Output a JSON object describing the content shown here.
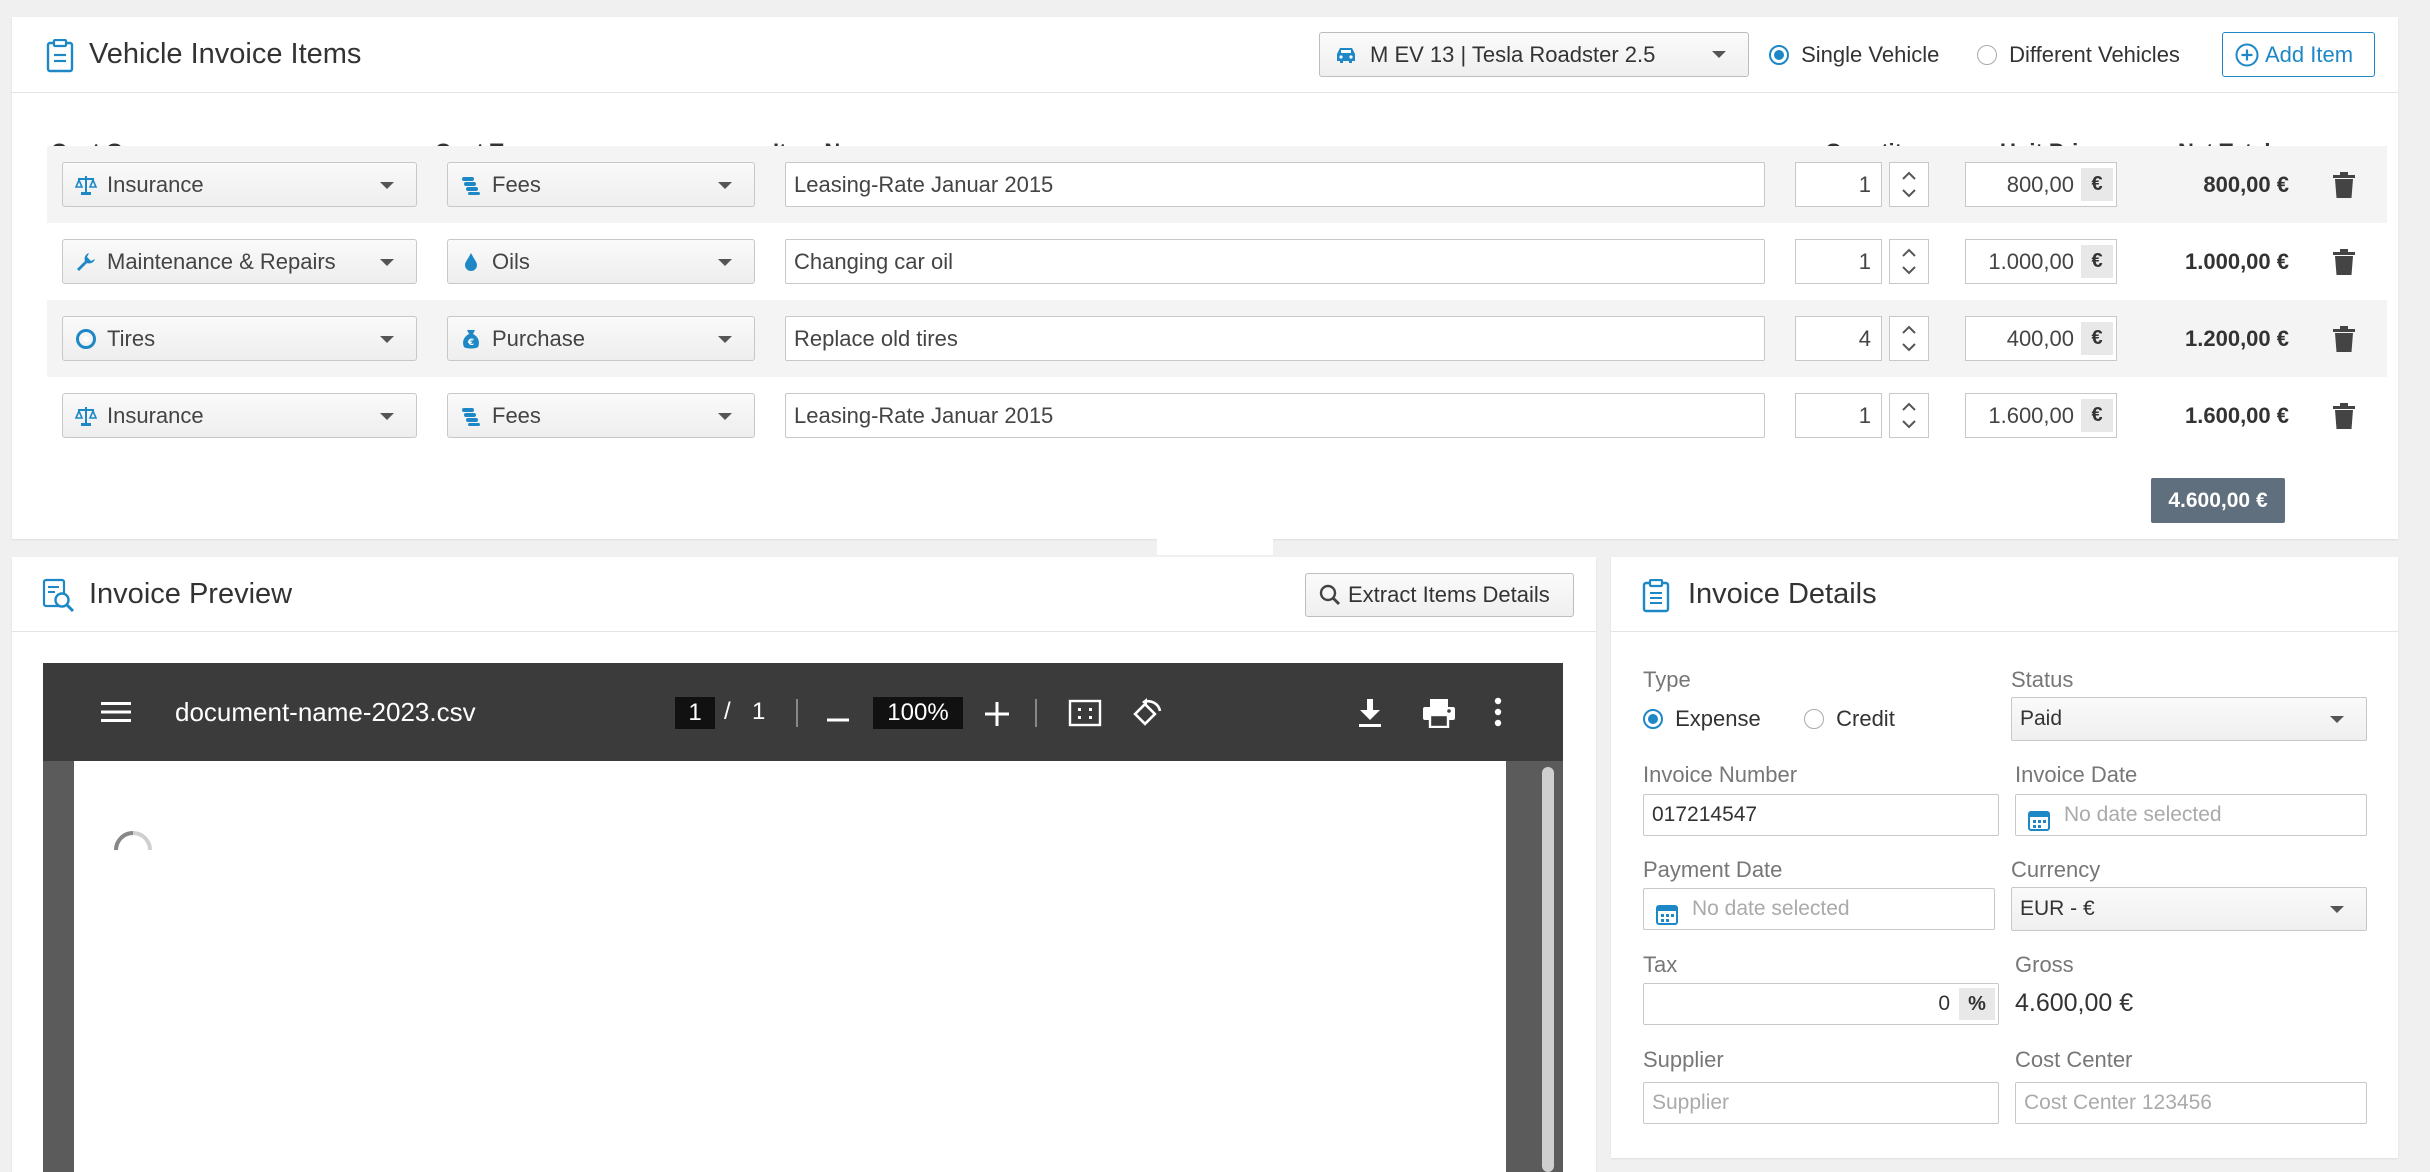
{
  "items_panel": {
    "title": "Vehicle Invoice Items",
    "vehicle_select": "M EV 13 | Tesla Roadster 2.5",
    "radio_single": "Single Vehicle",
    "radio_different": "Different Vehicles",
    "add_item": "Add Item",
    "columns": {
      "cost_group": "Cost Group",
      "cost_type": "Cost Type",
      "item_name": "Item Name",
      "quantity": "Quantity",
      "unit_price": "Unit Price",
      "net_total": "Net Total"
    },
    "rows": [
      {
        "cost_group": "Insurance",
        "cost_group_icon": "scale-icon",
        "cost_type": "Fees",
        "cost_type_icon": "coins-icon",
        "item_name": "Leasing-Rate Januar 2015",
        "quantity": "1",
        "unit_price": "800,00",
        "currency": "€",
        "net_total": "800,00 €"
      },
      {
        "cost_group": "Maintenance & Repairs",
        "cost_group_icon": "wrench-icon",
        "cost_type": "Oils",
        "cost_type_icon": "drop-icon",
        "item_name": "Changing car oil",
        "quantity": "1",
        "unit_price": "1.000,00",
        "currency": "€",
        "net_total": "1.000,00 €"
      },
      {
        "cost_group": "Tires",
        "cost_group_icon": "tire-icon",
        "cost_type": "Purchase",
        "cost_type_icon": "money-bag-icon",
        "item_name": "Replace old tires",
        "quantity": "4",
        "unit_price": "400,00",
        "currency": "€",
        "net_total": "1.200,00 €"
      },
      {
        "cost_group": "Insurance",
        "cost_group_icon": "scale-icon",
        "cost_type": "Fees",
        "cost_type_icon": "coins-icon",
        "item_name": "Leasing-Rate Januar 2015",
        "quantity": "1",
        "unit_price": "1.600,00",
        "currency": "€",
        "net_total": "1.600,00 €"
      }
    ],
    "grand_total": "4.600,00 €"
  },
  "preview_panel": {
    "title": "Invoice Preview",
    "extract_button": "Extract Items Details",
    "viewer": {
      "file_name": "document-name-2023.csv",
      "page_current": "1",
      "page_sep": "/",
      "page_total": "1",
      "zoom": "100%"
    }
  },
  "details_panel": {
    "title": "Invoice Details",
    "type_label": "Type",
    "type_expense": "Expense",
    "type_credit": "Credit",
    "status_label": "Status",
    "status_value": "Paid",
    "invoice_number_label": "Invoice Number",
    "invoice_number_value": "017214547",
    "invoice_date_label": "Invoice Date",
    "invoice_date_placeholder": "No date selected",
    "payment_date_label": "Payment Date",
    "payment_date_placeholder": "No date selected",
    "currency_label": "Currency",
    "currency_value": "EUR - €",
    "tax_label": "Tax",
    "tax_value": "0",
    "tax_unit": "%",
    "gross_label": "Gross",
    "gross_value": "4.600,00 €",
    "supplier_label": "Supplier",
    "supplier_placeholder": "Supplier",
    "cost_center_label": "Cost Center",
    "cost_center_placeholder": "Cost Center 123456"
  },
  "colors": {
    "accent": "#1e88c7",
    "total_badge": "#5f6f7d",
    "pdf_toolbar": "#3b3b3b"
  }
}
